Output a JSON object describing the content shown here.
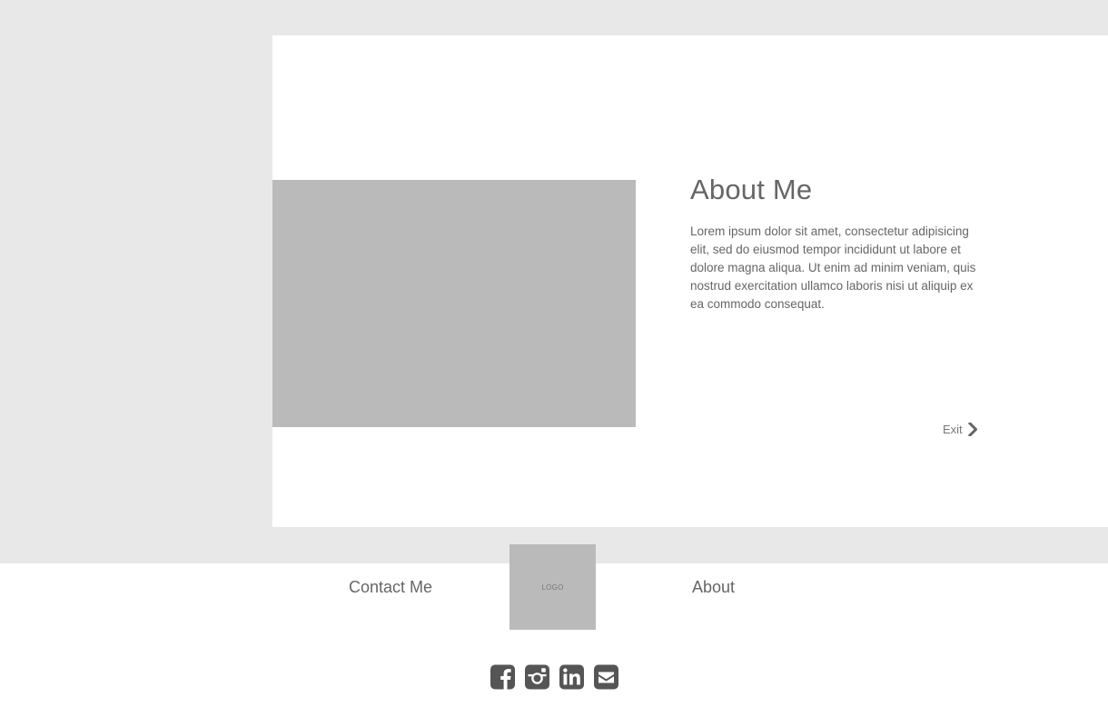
{
  "about": {
    "title": "About Me",
    "body": "Lorem ipsum dolor sit amet, consectetur adipisicing elit, sed do eiusmod tempor incididunt ut labore et dolore magna aliqua. Ut enim ad minim veniam, quis nostrud exercitation ullamco laboris nisi ut aliquip ex ea commodo consequat.",
    "exit_label": "Exit",
    "exit_icon": "chevron-right-icon"
  },
  "footer": {
    "logo_text": "LOGO",
    "nav": {
      "contact_label": "Contact Me",
      "about_label": "About"
    },
    "social": [
      {
        "icon": "facebook-icon"
      },
      {
        "icon": "instagram-icon"
      },
      {
        "icon": "linkedin-icon"
      },
      {
        "icon": "email-icon"
      }
    ]
  },
  "colors": {
    "background": "#e8e8e8",
    "card": "#ffffff",
    "placeholder": "#bababa",
    "text": "#666666",
    "icon": "#555555"
  }
}
